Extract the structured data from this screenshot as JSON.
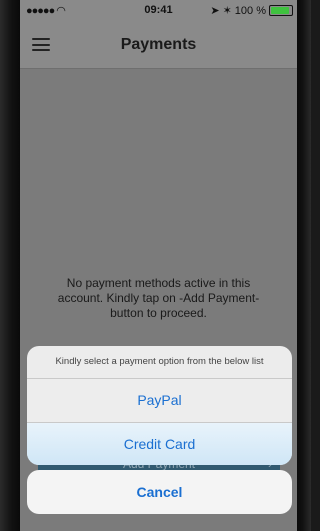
{
  "status_bar": {
    "signal": "●●●●●",
    "wifi_icon": "wifi-icon",
    "time": "09:41",
    "battery_percent": "100 %",
    "battery_level": 1.0
  },
  "nav": {
    "title": "Payments"
  },
  "main": {
    "empty_message": "No payment methods active in this account. Kindly tap on -Add Payment- button to proceed.",
    "add_payment_label": "Add Payment",
    "add_payment_chevron": "›"
  },
  "action_sheet": {
    "title": "Kindly select a payment option from the below list",
    "options": [
      {
        "label": "PayPal"
      },
      {
        "label": "Credit Card"
      }
    ],
    "cancel_label": "Cancel"
  },
  "colors": {
    "accent": "#1a6fd1",
    "button_bg": "#315a70"
  }
}
